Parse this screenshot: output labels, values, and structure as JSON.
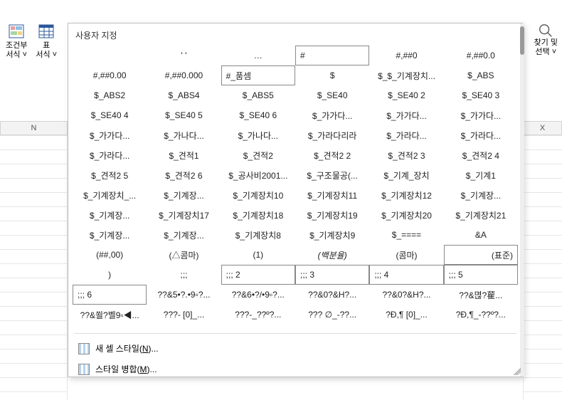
{
  "ribbon": {
    "conditional": {
      "label1": "조건부",
      "label2": "서식 ˅"
    },
    "table": {
      "label1": "표",
      "label2": "서식 ˅"
    },
    "find": {
      "label1": "찾기 및",
      "label2": "선택 ˅"
    }
  },
  "dropdown": {
    "title": "사용자 지정",
    "rows": [
      {
        "cells": [
          {
            "text": ""
          },
          {
            "text": "' '"
          },
          {
            "text": "…"
          },
          {
            "text": "#",
            "style": "boxed"
          },
          {
            "text": "#,##0"
          },
          {
            "text": "#,##0.0"
          }
        ]
      },
      {
        "cells": [
          {
            "text": "#,##0.00"
          },
          {
            "text": "#,##0.000"
          },
          {
            "text": "#_품셈",
            "style": "boxed"
          },
          {
            "text": "$"
          },
          {
            "text": "$_$_기계장치..."
          },
          {
            "text": "$_ABS"
          }
        ]
      },
      {
        "cells": [
          {
            "text": "$_ABS2"
          },
          {
            "text": "$_ABS4"
          },
          {
            "text": "$_ABS5"
          },
          {
            "text": "$_SE40"
          },
          {
            "text": "$_SE40 2"
          },
          {
            "text": "$_SE40 3"
          }
        ]
      },
      {
        "cells": [
          {
            "text": "$_SE40 4"
          },
          {
            "text": "$_SE40 5"
          },
          {
            "text": "$_SE40 6"
          },
          {
            "text": "$_가가다..."
          },
          {
            "text": "$_가가다..."
          },
          {
            "text": "$_가가다..."
          }
        ]
      },
      {
        "cells": [
          {
            "text": "$_가가다..."
          },
          {
            "text": "$_가나다..."
          },
          {
            "text": "$_가나다..."
          },
          {
            "text": "$_가라다리라"
          },
          {
            "text": "$_가라다..."
          },
          {
            "text": "$_가라다..."
          }
        ]
      },
      {
        "cells": [
          {
            "text": "$_가라다..."
          },
          {
            "text": "$_견적1"
          },
          {
            "text": "$_견적2"
          },
          {
            "text": "$_견적2 2"
          },
          {
            "text": "$_견적2 3"
          },
          {
            "text": "$_견적2 4"
          }
        ]
      },
      {
        "cells": [
          {
            "text": "$_견적2 5"
          },
          {
            "text": "$_견적2 6"
          },
          {
            "text": "$_공사비2001..."
          },
          {
            "text": "$_구조물공(..."
          },
          {
            "text": "$_기계_장치"
          },
          {
            "text": "$_기계1"
          }
        ]
      },
      {
        "cells": [
          {
            "text": "$_기계장치_..."
          },
          {
            "text": "$_기계장..."
          },
          {
            "text": "$_기계장치10"
          },
          {
            "text": "$_기계장치11"
          },
          {
            "text": "$_기계장치12"
          },
          {
            "text": "$_기계장..."
          }
        ]
      },
      {
        "cells": [
          {
            "text": "$_기계장..."
          },
          {
            "text": "$_기계장치17"
          },
          {
            "text": "$_기계장치18"
          },
          {
            "text": "$_기계장치19"
          },
          {
            "text": "$_기계장치20"
          },
          {
            "text": "$_기계장치21"
          }
        ]
      },
      {
        "cells": [
          {
            "text": "$_기계장..."
          },
          {
            "text": "$_기계장..."
          },
          {
            "text": "$_기계장치8"
          },
          {
            "text": "$_기계장치9"
          },
          {
            "text": "$_===="
          },
          {
            "text": "&A"
          }
        ]
      },
      {
        "cells": [
          {
            "text": "(##,00)"
          },
          {
            "text": "(△콤마)"
          },
          {
            "text": "(1)"
          },
          {
            "text": "(백분율)",
            "style": "italic"
          },
          {
            "text": "(콤마)"
          },
          {
            "text": "(표준)",
            "style": "boxed-right"
          }
        ]
      },
      {
        "cells": [
          {
            "text": ")"
          },
          {
            "text": ";;;"
          },
          {
            "text": ";;; 2",
            "style": "boxed"
          },
          {
            "text": ";;; 3",
            "style": "boxed"
          },
          {
            "text": ";;; 4",
            "style": "boxed"
          },
          {
            "text": ";;; 5",
            "style": "boxed"
          }
        ]
      },
      {
        "cells": [
          {
            "text": ";;; 6",
            "style": "boxed"
          },
          {
            "text": "??&5•?.•9▫?..."
          },
          {
            "text": "??&6•?/•9▫?..."
          },
          {
            "text": "??&0?&H?..."
          },
          {
            "text": "??&0?&H?..."
          },
          {
            "text": "??&멶?雚..."
          }
        ]
      },
      {
        "cells": [
          {
            "text": "??&쐴?벨9▫◀..."
          },
          {
            "text": "???- [0]_..."
          },
          {
            "text": "???-_??º?..."
          },
          {
            "text": "??? ∅_-??..."
          },
          {
            "text": "?Đ,¶ [0]_..."
          },
          {
            "text": "?Đ,¶_-??º?..."
          }
        ]
      }
    ],
    "menu": {
      "newStyle": {
        "pre": "새 셀 스타일(",
        "accel": "N",
        "post": ")..."
      },
      "merge": {
        "pre": "스타일 병합(",
        "accel": "M",
        "post": ")..."
      }
    }
  },
  "sheet": {
    "colN": "N",
    "colX": "X"
  }
}
